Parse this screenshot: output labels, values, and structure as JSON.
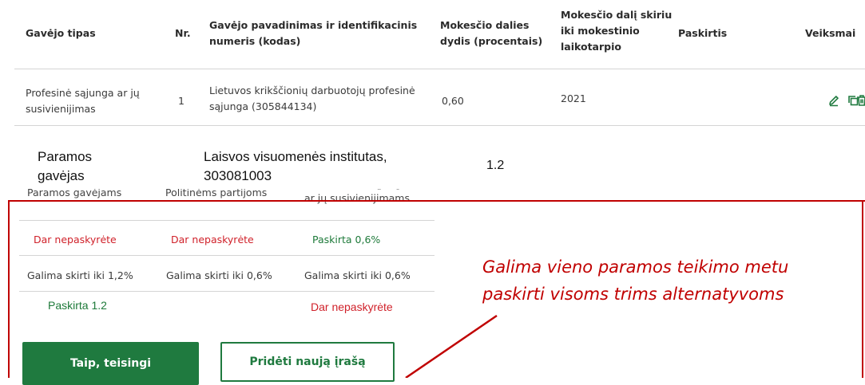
{
  "table": {
    "headers": {
      "type": "Gavėjo tipas",
      "nr": "Nr.",
      "name_l1": "Gavėjo pavadinimas ir identifikacinis",
      "name_l2": "numeris (kodas)",
      "size_l1": "Mokesčio dalies",
      "size_l2": "dydis (procentais)",
      "period_l1": "Mokesčio dalį skiriu",
      "period_l2": "iki mokestinio",
      "period_l3": "laikotarpio",
      "purpose": "Paskirtis",
      "actions": "Veiksmai"
    },
    "row1": {
      "type_l1": "Profesinė sąjunga ar jų",
      "type_l2": "susivienijimas",
      "nr": "1",
      "name_l1": "Lietuvos krikščionių darbuotojų profesinė",
      "name_l2": "sąjunga (305844134)",
      "size": "0,60",
      "period": "2021",
      "icons": [
        "edit-icon",
        "copy-icon",
        "delete-icon"
      ]
    }
  },
  "overlay_row": {
    "type_l1": "Paramos",
    "type_l2": "gavėjas",
    "name_l1": "Laisvos visuomenės institutas,",
    "name_l2": "303081003",
    "size": "1.2"
  },
  "cut_row": {
    "col1": "Paramos gavėjams",
    "col2": "Politinėms partijoms",
    "col3_l1": "Profesinėms sąjungoms",
    "col3_l2": "ar jų susivienijimams"
  },
  "status_row": {
    "col1": "Dar nepaskyrėte",
    "col2": "Dar nepaskyrėte",
    "col3": "Paskirta 0,6%"
  },
  "limit_row": {
    "col1": "Galima skirti iki 1,2%",
    "col2": "Galima skirti iki 0,6%",
    "col3": "Galima skirti iki 0,6%"
  },
  "override_row": {
    "col1": "Paskirta 1.2",
    "col3": "Dar nepaskyrėte"
  },
  "annotation": {
    "line1": "Galima vieno paramos teikimo metu",
    "line2": "paskirti visoms trims alternatyvoms"
  },
  "buttons": {
    "confirm": "Taip, teisingi",
    "add": "Pridėti naują įrašą"
  },
  "colors": {
    "accent_green": "#1f7a3f",
    "annotation_red": "#c00000",
    "status_red": "#d0212a"
  }
}
